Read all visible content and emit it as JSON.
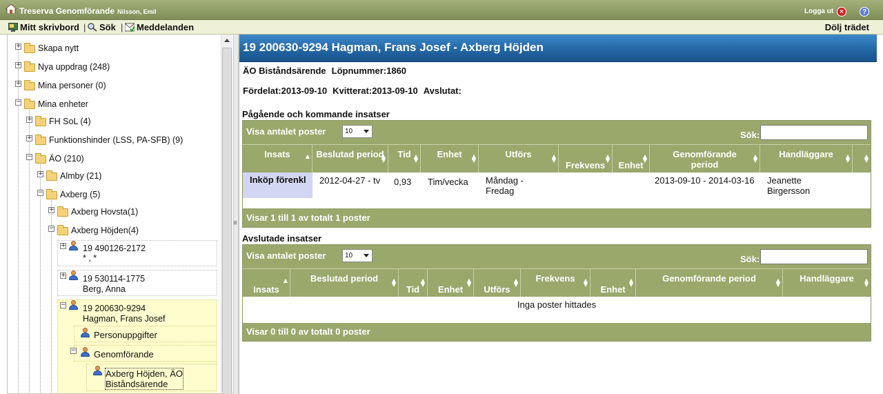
{
  "titlebar": {
    "app_title": "Treserva Genomförande",
    "user": "Nilsson, Emil",
    "logout": "Logga ut"
  },
  "toolbar": {
    "desktop": "Mitt skrivbord",
    "search": "Sök",
    "messages": "Meddelanden",
    "hide_tree": "Dölj trädet"
  },
  "tree": {
    "create_new": "Skapa nytt",
    "new_assignments": "Nya uppdrag (248)",
    "my_persons": "Mina personer (0)",
    "my_units": "Mina enheter",
    "fh_sol": "FH SoL (4)",
    "funktionshinder": "Funktionshinder (LSS, PA-SFB) (9)",
    "ao": "ÄO (210)",
    "almby": "Almby (21)",
    "axberg": "Axberg (5)",
    "axberg_hovsta": "Axberg Hovsta(1)",
    "axberg_hojden": "Axberg Höjden(4)",
    "persons": [
      {
        "id": "19 490126-2172",
        "name": "* , *"
      },
      {
        "id": "19 530114-1775",
        "name": "Berg, Anna"
      },
      {
        "id": "19 200630-9294",
        "name": "Hagman, Frans Josef"
      }
    ],
    "personuppgifter": "Personuppgifter",
    "genomforande": "Genomförande",
    "case_line1": "Axberg Höjden, ÄO",
    "case_line2": "Biståndsärende"
  },
  "main": {
    "header_title": "19 200630-9294 Hagman, Frans Josef - Axberg Höjden",
    "case_type": "ÄO Biståndsärende",
    "lopnummer_label": "Löpnummer:",
    "lopnummer": "1860",
    "fordelat_label": "Fördelat:",
    "fordelat": "2013-09-10",
    "kvitterat_label": "Kvitterat:",
    "kvitterat": "2013-09-10",
    "avslutat_label": "Avslutat:",
    "ongoing_title": "Pågående och kommande insatser",
    "finished_title": "Avslutade insatser",
    "show_count_label": "Visa antalet poster",
    "page_size": "10",
    "search_label": "Sök:",
    "ongoing_headers": [
      "Insats",
      "Beslutad period",
      "Tid",
      "Enhet",
      "Utförs",
      "Frekvens",
      "Enhet",
      "Genomförande period",
      "Handläggare"
    ],
    "ongoing_rows": [
      {
        "insats": "Inköp förenkl",
        "beslutad_period": "2012-04-27 - tv",
        "tid": "0,93",
        "enhet": "Tim/vecka",
        "utfors": "Måndag - Fredag",
        "frekvens": "",
        "enhet2": "",
        "genomforande_period": "2013-09-10 - 2014-03-16",
        "handlaggare": "Jeanette Birgersson"
      }
    ],
    "ongoing_footer": "Visar 1 till 1 av totalt 1 poster",
    "finished_headers": [
      "Insats",
      "Beslutad period",
      "Tid",
      "Enhet",
      "Utförs",
      "Frekvens",
      "Enhet",
      "Genomförande period",
      "Handläggare"
    ],
    "finished_empty": "Inga poster hittades",
    "finished_footer": "Visar 0 till 0 av totalt 0 poster"
  }
}
